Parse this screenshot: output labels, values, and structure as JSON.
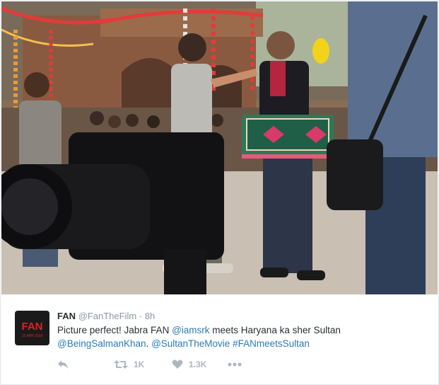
{
  "tweet": {
    "display_name": "FAN",
    "handle": "@FanTheFilm",
    "separator": "·",
    "timestamp": "8h",
    "avatar": {
      "wordmark": "FAN",
      "date_text": "15 APR 2016"
    },
    "text_segments": [
      {
        "text": "Picture perfect! Jabra FAN ",
        "type": "plain"
      },
      {
        "text": "@iamsrk",
        "type": "link"
      },
      {
        "text": " meets Haryana ka sher Sultan ",
        "type": "plain"
      },
      {
        "text": "@BeingSalmanKhan",
        "type": "link"
      },
      {
        "text": ". ",
        "type": "plain"
      },
      {
        "text": "@SultanTheMovie",
        "type": "link"
      },
      {
        "text": " ",
        "type": "plain"
      },
      {
        "text": "#FANmeetsSultan",
        "type": "link"
      }
    ],
    "actions": {
      "reply_icon": "reply-icon",
      "retweet_icon": "retweet-icon",
      "retweet_count": "1K",
      "like_icon": "heart-icon",
      "like_count": "1.3K",
      "more_icon": "more-dots-icon"
    },
    "colors": {
      "link": "#2b7bb9",
      "name": "#292f33",
      "muted": "#8899a6",
      "action": "#aab8c2",
      "avatar_bg": "#1a1a1a",
      "avatar_text": "#e02020"
    }
  }
}
